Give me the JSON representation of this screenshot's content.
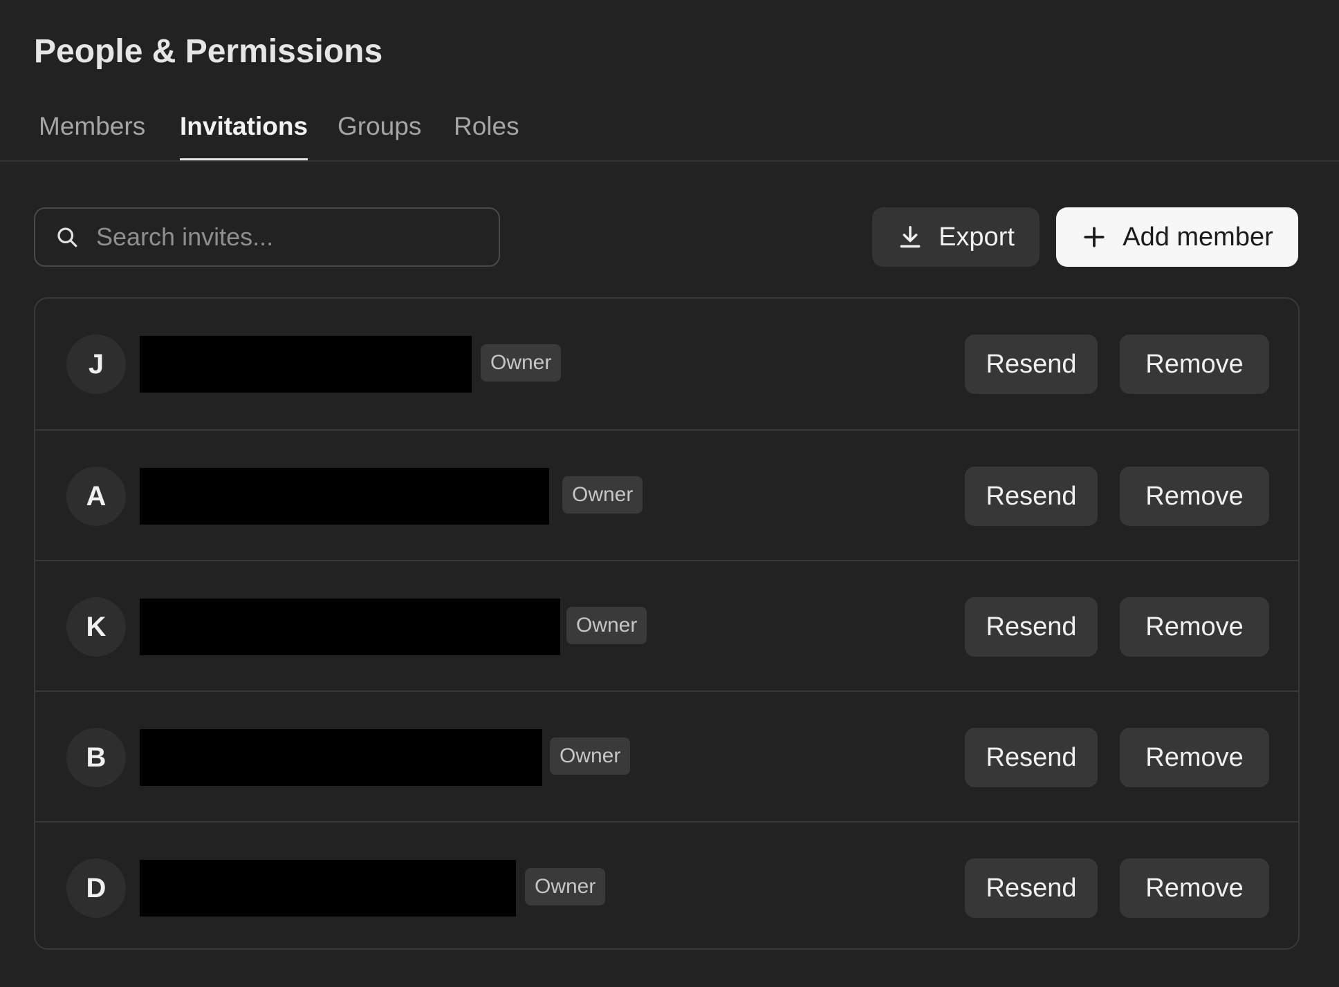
{
  "header": {
    "title": "People & Permissions"
  },
  "tabs": [
    {
      "label": "Members",
      "active": false
    },
    {
      "label": "Invitations",
      "active": true
    },
    {
      "label": "Groups",
      "active": false
    },
    {
      "label": "Roles",
      "active": false
    }
  ],
  "search": {
    "placeholder": "Search invites...",
    "value": "",
    "icon": "search-icon"
  },
  "toolbar": {
    "export_label": "Export",
    "export_icon": "download-icon",
    "add_label": "Add member",
    "add_icon": "plus-icon"
  },
  "invites": [
    {
      "initial": "J",
      "name": "[redacted]",
      "role": "Owner",
      "resend_label": "Resend",
      "remove_label": "Remove"
    },
    {
      "initial": "A",
      "name": "[redacted]",
      "role": "Owner",
      "resend_label": "Resend",
      "remove_label": "Remove"
    },
    {
      "initial": "K",
      "name": "[redacted]",
      "role": "Owner",
      "resend_label": "Resend",
      "remove_label": "Remove"
    },
    {
      "initial": "B",
      "name": "[redacted]",
      "role": "Owner",
      "resend_label": "Resend",
      "remove_label": "Remove"
    },
    {
      "initial": "D",
      "name": "[redacted]",
      "role": "Owner",
      "resend_label": "Resend",
      "remove_label": "Remove"
    }
  ],
  "colors": {
    "background": "#222222",
    "primary_button": "#f7f7f7",
    "secondary_button": "#373737",
    "redaction": "#000000"
  }
}
